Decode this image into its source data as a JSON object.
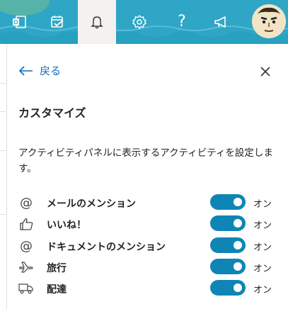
{
  "topbar": {
    "buttons": [
      {
        "name": "office-apps",
        "icon": "office-icon"
      },
      {
        "name": "my-day",
        "icon": "calendar-check-icon"
      },
      {
        "name": "notifications",
        "icon": "bell-icon",
        "active": true
      },
      {
        "name": "settings",
        "icon": "gear-icon"
      },
      {
        "name": "help",
        "icon": "question-icon",
        "glyph": "?"
      },
      {
        "name": "whats-new",
        "icon": "megaphone-icon"
      }
    ],
    "avatar": "avatar"
  },
  "panel": {
    "back_label": "戻る",
    "title": "カスタマイズ",
    "description": "アクティビティパネルに表示するアクティビティを設定します。",
    "items": [
      {
        "icon": "at-sign-icon",
        "glyph": "@",
        "label": "メールのメンション",
        "state": "オン",
        "on": true
      },
      {
        "icon": "thumbs-up-icon",
        "label": "いいね！",
        "state": "オン",
        "on": true
      },
      {
        "icon": "at-sign-icon",
        "glyph": "@",
        "label": "ドキュメントのメンション",
        "state": "オン",
        "on": true
      },
      {
        "icon": "airplane-icon",
        "label": "旅行",
        "state": "オン",
        "on": true
      },
      {
        "icon": "truck-icon",
        "label": "配達",
        "state": "オン",
        "on": true
      }
    ]
  },
  "colors": {
    "topbar": "#2fa6c6",
    "toggle_on": "#0f85b6",
    "link": "#0f6cbd"
  }
}
